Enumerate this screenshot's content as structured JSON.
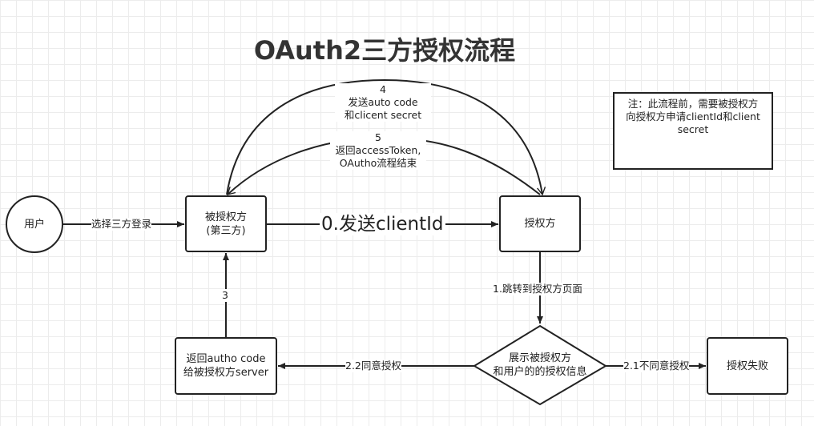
{
  "title": "OAuth2三方授权流程",
  "nodes": {
    "user": "用户",
    "client": [
      "被授权方",
      "(第三方)"
    ],
    "auth_server": "授权方",
    "show_info": [
      "展示被授权方",
      "和用户的的授权信息"
    ],
    "return_code": [
      "返回autho code",
      "给被授权方server"
    ],
    "auth_fail": "授权失败"
  },
  "edges": {
    "select_login": "选择三方登录",
    "send_client_id": "0.发送clientId",
    "redirect": "1.跳转到授权方页面",
    "agree": "2.2同意授权",
    "disagree": "2.1不同意授权",
    "step3": "3",
    "step4": [
      "4",
      "发送auto code",
      "和clicent secret"
    ],
    "step5": [
      "5",
      "返回accessToken,",
      "OAutho流程结束"
    ]
  },
  "note": [
    "注：此流程前，需要被授权方",
    "向授权方申请clientId和client",
    "secret"
  ],
  "colors": {
    "stroke": "#222222",
    "background": "#ffffff",
    "grid": "#ececec"
  }
}
